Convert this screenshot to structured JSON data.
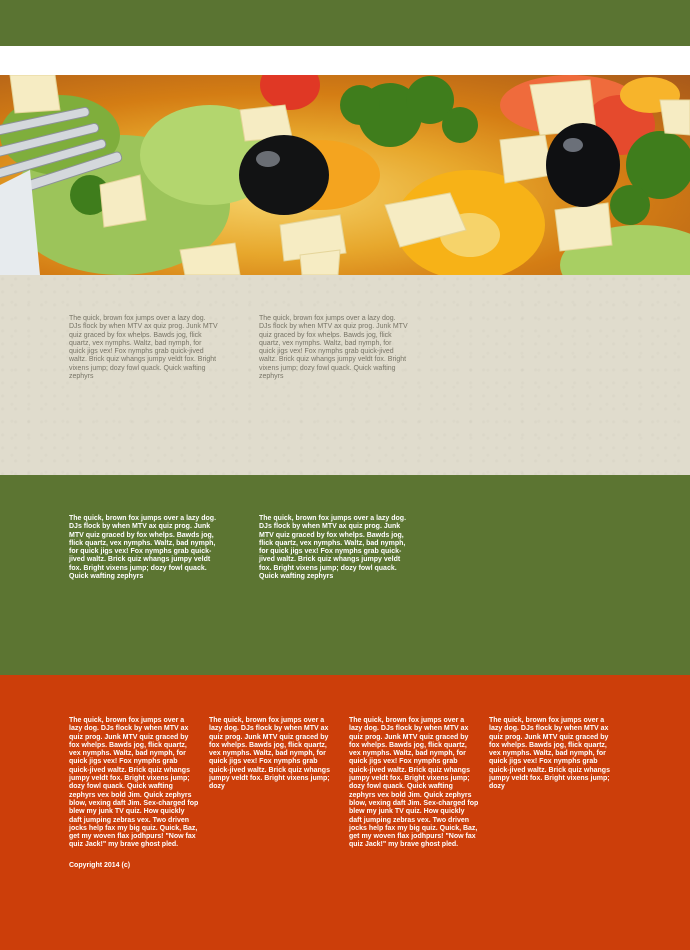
{
  "hero": {
    "image_name": "salad-photo"
  },
  "colors": {
    "header_green": "#5a7432",
    "beige": "#e0dccd",
    "green": "#5c7532",
    "orange": "#cc3e0a"
  },
  "section_beige": {
    "columns": [
      "The quick, brown fox jumps over a lazy dog. DJs flock by when MTV ax quiz prog. Junk MTV quiz graced by fox whelps. Bawds jog, flick quartz, vex nymphs. Waltz, bad nymph, for quick jigs vex! Fox nymphs grab quick-jived waltz. Brick quiz whangs jumpy veldt fox. Bright vixens jump; dozy fowl quack. Quick wafting zephyrs",
      "The quick, brown fox jumps over a lazy dog. DJs flock by when MTV ax quiz prog. Junk MTV quiz graced by fox whelps. Bawds jog, flick quartz, vex nymphs. Waltz, bad nymph, for quick jigs vex! Fox nymphs grab quick-jived waltz. Brick quiz whangs jumpy veldt fox. Bright vixens jump; dozy fowl quack. Quick wafting zephyrs"
    ]
  },
  "section_green": {
    "columns": [
      "The quick, brown fox jumps over a lazy dog. DJs flock by when MTV ax quiz prog. Junk MTV quiz graced by fox whelps. Bawds jog, flick quartz, vex nymphs. Waltz, bad nymph, for quick jigs vex! Fox nymphs grab quick-jived waltz. Brick quiz whangs jumpy veldt fox. Bright vixens jump; dozy fowl quack. Quick wafting zephyrs",
      "The quick, brown fox jumps over a lazy dog. DJs flock by when MTV ax quiz prog. Junk MTV quiz graced by fox whelps. Bawds jog, flick quartz, vex nymphs. Waltz, bad nymph, for quick jigs vex! Fox nymphs grab quick-jived waltz. Brick quiz whangs jumpy veldt fox. Bright vixens jump; dozy fowl quack. Quick wafting zephyrs"
    ]
  },
  "section_orange": {
    "columns": [
      "The quick, brown fox jumps over a lazy dog. DJs flock by when MTV ax quiz prog. Junk MTV quiz graced by fox whelps. Bawds jog, flick quartz, vex nymphs. Waltz, bad nymph, for quick jigs vex! Fox nymphs grab quick-jived waltz. Brick quiz whangs jumpy veldt fox. Bright vixens jump; dozy fowl quack. Quick wafting zephyrs vex bold Jim. Quick zephyrs blow, vexing daft Jim. Sex-charged fop blew my junk TV quiz. How quickly daft jumping zebras vex. Two driven jocks help fax my big quiz. Quick, Baz, get my woven flax jodhpurs! \"Now fax quiz Jack!\" my brave ghost pled.",
      "The quick, brown fox jumps over a lazy dog. DJs flock by when MTV ax quiz prog. Junk MTV quiz graced by fox whelps. Bawds jog, flick quartz, vex nymphs. Waltz, bad nymph, for quick jigs vex! Fox nymphs grab quick-jived waltz. Brick quiz whangs jumpy veldt fox. Bright vixens jump; dozy",
      "The quick, brown fox jumps over a lazy dog. DJs flock by when MTV ax quiz prog. Junk MTV quiz graced by fox whelps. Bawds jog, flick quartz, vex nymphs. Waltz, bad nymph, for quick jigs vex! Fox nymphs grab quick-jived waltz. Brick quiz whangs jumpy veldt fox. Bright vixens jump; dozy fowl quack. Quick wafting zephyrs vex bold Jim. Quick zephyrs blow, vexing daft Jim. Sex-charged fop blew my junk TV quiz. How quickly daft jumping zebras vex. Two driven jocks help fax my big quiz. Quick, Baz, get my woven flax jodhpurs! \"Now fax quiz Jack!\" my brave ghost pled.",
      "The quick, brown fox jumps over a lazy dog. DJs flock by when MTV ax quiz prog. Junk MTV quiz graced by fox whelps. Bawds jog, flick quartz, vex nymphs. Waltz, bad nymph, for quick jigs vex! Fox nymphs grab quick-jived waltz. Brick quiz whangs jumpy veldt fox. Bright vixens jump; dozy"
    ],
    "copyright": "Copyright 2014 (c)"
  }
}
